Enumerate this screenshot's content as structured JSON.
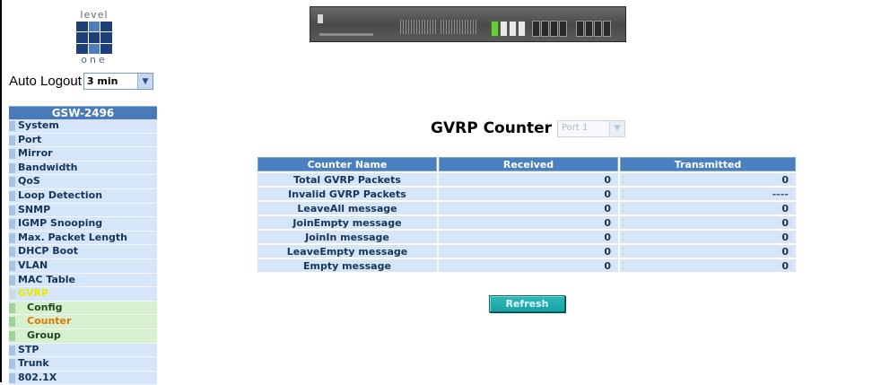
{
  "logo": {
    "top_text": "level",
    "bottom_text": "one"
  },
  "auto_logout": {
    "label": "Auto Logout",
    "selected": "3 min"
  },
  "sidebar": {
    "header": "GSW-2496",
    "items": [
      {
        "label": "System"
      },
      {
        "label": "Port"
      },
      {
        "label": "Mirror"
      },
      {
        "label": "Bandwidth"
      },
      {
        "label": "QoS"
      },
      {
        "label": "Loop Detection"
      },
      {
        "label": "SNMP"
      },
      {
        "label": "IGMP Snooping"
      },
      {
        "label": "Max. Packet Length"
      },
      {
        "label": "DHCP Boot"
      },
      {
        "label": "VLAN"
      },
      {
        "label": "MAC Table"
      },
      {
        "label": "GVRP"
      }
    ],
    "subitems": [
      {
        "label": "Config"
      },
      {
        "label": "Counter"
      },
      {
        "label": "Group"
      }
    ],
    "items_after": [
      {
        "label": "STP"
      },
      {
        "label": "Trunk"
      },
      {
        "label": "802.1X"
      }
    ]
  },
  "main": {
    "title": "GVRP Counter",
    "port_select": "Port 1",
    "columns": [
      "Counter Name",
      "Received",
      "Transmitted"
    ],
    "rows": [
      {
        "name": "Total GVRP Packets",
        "received": "0",
        "transmitted": "0"
      },
      {
        "name": "Invalid GVRP Packets",
        "received": "0",
        "transmitted": "----"
      },
      {
        "name": "LeaveAll message",
        "received": "0",
        "transmitted": "0"
      },
      {
        "name": "JoinEmpty message",
        "received": "0",
        "transmitted": "0"
      },
      {
        "name": "JoinIn message",
        "received": "0",
        "transmitted": "0"
      },
      {
        "name": "LeaveEmpty message",
        "received": "0",
        "transmitted": "0"
      },
      {
        "name": "Empty message",
        "received": "0",
        "transmitted": "0"
      }
    ],
    "refresh_label": "Refresh"
  },
  "colors": {
    "sidebar_header": "#4a7ab8",
    "sidebar_item_bg": "#d6e6f8",
    "sidebar_sub_bg": "#d6f0d0",
    "active_item": "#e8e800",
    "current_subitem": "#e07800",
    "table_header": "#4a80c0",
    "table_cell": "#d6e6f8",
    "refresh_button": "#18a4a4"
  }
}
